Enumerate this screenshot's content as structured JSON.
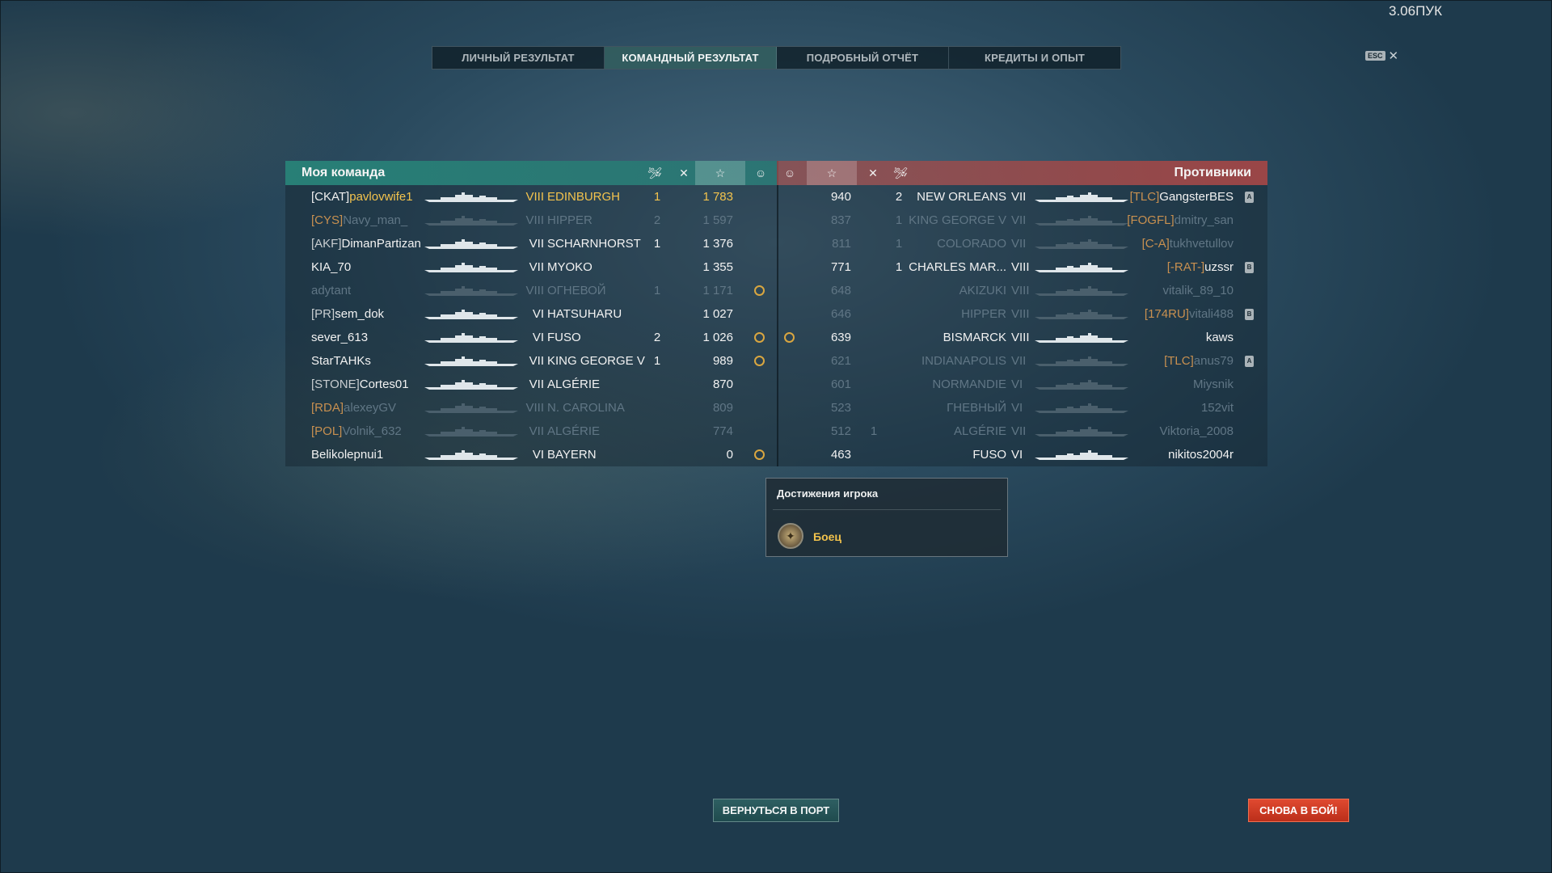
{
  "fps": "3.06ПУК",
  "tabs": [
    {
      "label": "Личный результат",
      "active": false
    },
    {
      "label": "Командный результат",
      "active": true
    },
    {
      "label": "Подробный отчёт",
      "active": false
    },
    {
      "label": "Кредиты и опыт",
      "active": false
    }
  ],
  "esc": {
    "key": "ESC",
    "close": "✕"
  },
  "my_team": {
    "title": "Моя команда",
    "header_icons": {
      "planes": "🛩",
      "kills": "✕",
      "exp": "☆",
      "achievement": "☺"
    },
    "players": [
      {
        "clan": "[CKAT]",
        "name": "pavlovwife1",
        "tier": "VIII",
        "ship": "EDINBURGH",
        "kills": "1",
        "exp": "1 783",
        "medal": false,
        "state": "highlight"
      },
      {
        "clan": "[CYS]",
        "name": "Navy_man_",
        "tier": "VIII",
        "ship": "HIPPER",
        "kills": "2",
        "exp": "1 597",
        "medal": false,
        "state": "dead"
      },
      {
        "clan": "[AKF]",
        "name": "DimanPartizan",
        "tier": "VII",
        "ship": "SCHARNHORST",
        "kills": "1",
        "exp": "1 376",
        "medal": false,
        "state": "alive"
      },
      {
        "clan": "",
        "name": "KIA_70",
        "tier": "VII",
        "ship": "MYOKO",
        "kills": "",
        "exp": "1 355",
        "medal": false,
        "state": "alive"
      },
      {
        "clan": "",
        "name": "adytant",
        "tier": "VIII",
        "ship": "ОГНЕВОЙ",
        "kills": "1",
        "exp": "1 171",
        "medal": true,
        "state": "dead"
      },
      {
        "clan": "[PR]",
        "name": "sem_dok",
        "tier": "VI",
        "ship": "HATSUHARU",
        "kills": "",
        "exp": "1 027",
        "medal": false,
        "state": "alive"
      },
      {
        "clan": "",
        "name": "sever_613",
        "tier": "VI",
        "ship": "FUSO",
        "kills": "2",
        "exp": "1 026",
        "medal": true,
        "state": "alive"
      },
      {
        "clan": "",
        "name": "StarTAHKs",
        "tier": "VII",
        "ship": "KING GEORGE V",
        "kills": "1",
        "exp": "989",
        "medal": true,
        "state": "alive"
      },
      {
        "clan": "[STONE]",
        "name": "Cortes01",
        "tier": "VII",
        "ship": "ALGÉRIE",
        "kills": "",
        "exp": "870",
        "medal": false,
        "state": "alive"
      },
      {
        "clan": "[RDA]",
        "name": "alexeyGV",
        "tier": "VIII",
        "ship": "N. CAROLINA",
        "kills": "",
        "exp": "809",
        "medal": false,
        "state": "dead"
      },
      {
        "clan": "[POL]",
        "name": "Volnik_632",
        "tier": "VII",
        "ship": "ALGÉRIE",
        "kills": "",
        "exp": "774",
        "medal": false,
        "state": "dead"
      },
      {
        "clan": "",
        "name": "Belikolepnui1",
        "tier": "VI",
        "ship": "BAYERN",
        "kills": "",
        "exp": "0",
        "medal": true,
        "state": "alive"
      }
    ]
  },
  "enemy_team": {
    "title": "Противники",
    "header_icons": {
      "achievement": "☺",
      "exp": "☆",
      "kills": "✕",
      "planes": "🛩"
    },
    "players": [
      {
        "medal": false,
        "exp": "940",
        "planes": "",
        "kills": "2",
        "ship": "NEW ORLEANS",
        "tier": "VII",
        "clan": "[TLC]",
        "name": "GangsterBES",
        "badge": "A",
        "state": "alive"
      },
      {
        "medal": false,
        "exp": "837",
        "planes": "",
        "kills": "1",
        "ship": "KING GEORGE V",
        "tier": "VII",
        "clan": "[FOGFL]",
        "name": "dmitry_san",
        "badge": "",
        "state": "dead"
      },
      {
        "medal": false,
        "exp": "811",
        "planes": "",
        "kills": "1",
        "ship": "COLORADO",
        "tier": "VII",
        "clan": "[C-A]",
        "name": "tukhvetullov",
        "badge": "",
        "state": "dead"
      },
      {
        "medal": false,
        "exp": "771",
        "planes": "",
        "kills": "1",
        "ship": "CHARLES MAR...",
        "tier": "VIII",
        "clan": "[-RAT-]",
        "name": "uzssr",
        "badge": "B",
        "state": "alive"
      },
      {
        "medal": false,
        "exp": "648",
        "planes": "",
        "kills": "",
        "ship": "AKIZUKI",
        "tier": "VIII",
        "clan": "",
        "name": "vitalik_89_10",
        "badge": "",
        "state": "dead"
      },
      {
        "medal": false,
        "exp": "646",
        "planes": "",
        "kills": "",
        "ship": "HIPPER",
        "tier": "VIII",
        "clan": "[174RU]",
        "name": "vitali488",
        "badge": "B",
        "state": "dead"
      },
      {
        "medal": true,
        "exp": "639",
        "planes": "",
        "kills": "",
        "ship": "BISMARCK",
        "tier": "VIII",
        "clan": "",
        "name": "kaws",
        "badge": "",
        "state": "alive"
      },
      {
        "medal": false,
        "exp": "621",
        "planes": "",
        "kills": "",
        "ship": "INDIANAPOLIS",
        "tier": "VII",
        "clan": "[TLC]",
        "name": "anus79",
        "badge": "A",
        "state": "dead"
      },
      {
        "medal": false,
        "exp": "601",
        "planes": "",
        "kills": "",
        "ship": "NORMANDIE",
        "tier": "VI",
        "clan": "",
        "name": "Miysnik",
        "badge": "",
        "state": "dead"
      },
      {
        "medal": false,
        "exp": "523",
        "planes": "",
        "kills": "",
        "ship": "ГНЕВНЫЙ",
        "tier": "VI",
        "clan": "",
        "name": "152vit",
        "badge": "",
        "state": "dead"
      },
      {
        "medal": false,
        "exp": "512",
        "planes": "1",
        "kills": "",
        "ship": "ALGÉRIE",
        "tier": "VII",
        "clan": "",
        "name": "Viktoria_2008",
        "badge": "",
        "state": "dead"
      },
      {
        "medal": false,
        "exp": "463",
        "planes": "",
        "kills": "",
        "ship": "FUSO",
        "tier": "VI",
        "clan": "",
        "name": "nikitos2004r",
        "badge": "",
        "state": "alive"
      }
    ]
  },
  "achievements": {
    "title": "Достижения игрока",
    "items": [
      {
        "name": "Боец",
        "icon": "fighter-medal-icon"
      }
    ]
  },
  "buttons": {
    "return_port": "Вернуться в порт",
    "battle_again": "Снова в бой!"
  },
  "colors": {
    "accent_team": "#2a8278",
    "accent_enemy": "#a04848",
    "highlight": "#f3c34d",
    "battle_button": "#d23c22"
  }
}
